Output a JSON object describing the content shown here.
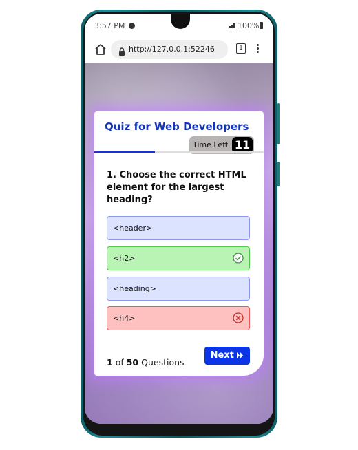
{
  "status_bar": {
    "time": "3:57 PM",
    "battery": "100%"
  },
  "browser": {
    "url": "http://127.0.0.1:52246",
    "tab_count": "1"
  },
  "quiz": {
    "title": "Quiz for Web Developers",
    "timer": {
      "label": "Time Left",
      "value": "11"
    },
    "question": "1. Choose the correct HTML element for the largest heading?",
    "options": [
      {
        "label": "<header>",
        "state": "normal"
      },
      {
        "label": "<h2>",
        "state": "correct"
      },
      {
        "label": "<heading>",
        "state": "normal"
      },
      {
        "label": "<h4>",
        "state": "wrong"
      }
    ],
    "progress": {
      "current": "1",
      "of": "of",
      "total": "50",
      "suffix": "Questions"
    },
    "next_button": "Next"
  },
  "icons": {
    "home": "home-icon",
    "lock": "lock-icon",
    "tabs": "tabs-icon",
    "menu": "menu-icon",
    "correct": "check-circle-icon",
    "wrong": "x-circle-icon",
    "next": "double-chevron-right-icon"
  },
  "colors": {
    "accent": "#0b34e6",
    "title": "#1437b5",
    "correct_bg": "#b9f4b4",
    "wrong_bg": "#ffc0c0",
    "option_bg": "#dbe3ff"
  }
}
